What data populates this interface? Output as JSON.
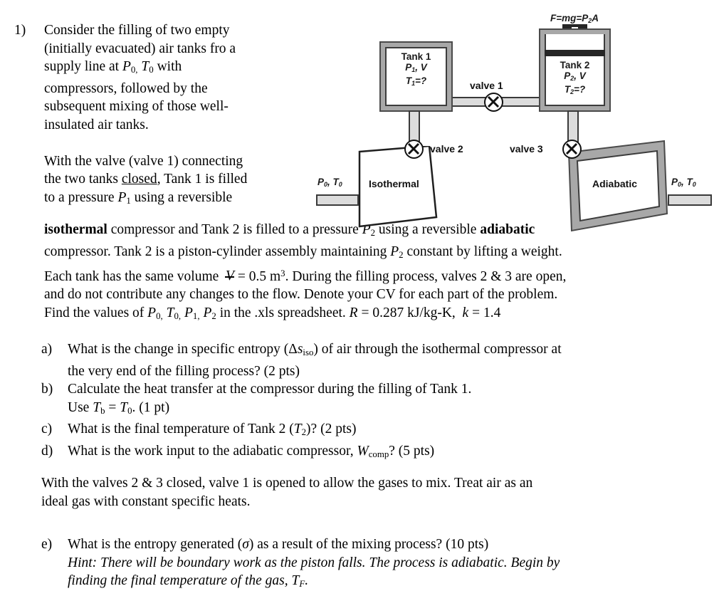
{
  "problem": {
    "number": "1)",
    "intro_lines": [
      "Consider the filling of two empty",
      "(initially evacuated) air tanks fro a",
      "supply line at P0, T0 with",
      "compressors, followed by the",
      "subsequent mixing of those well-",
      "insulated air tanks."
    ],
    "second_block_lines": [
      "With the valve (valve 1) connecting",
      "the two tanks closed, Tank 1 is filled",
      "to a pressure P1 using a reversible"
    ],
    "continuation": "isothermal compressor and Tank 2 is filled to a pressure P2 using a reversible adiabatic compressor. Tank 2 is a piston-cylinder assembly maintaining P2 constant by lifting a weight. Each tank has the same volume V = 0.5 m3. During the filling process, valves 2 & 3 are open, and do not contribute any changes to the flow. Denote your CV for each part of the problem. Find the values of P0, T0, P1, P2 in the .xls spreadsheet. R = 0.287 kJ/kg-K, k = 1.4",
    "emphasis": {
      "underlined_word": "closed",
      "bold_word_1": "isothermal",
      "bold_word_2": "adiabatic"
    },
    "constants": {
      "volume": "0.5 m3",
      "gas_constant": "0.287 kJ/kg-K",
      "k": "1.4"
    }
  },
  "questions": [
    {
      "marker": "a)",
      "lines": [
        "What is the change in specific entropy (Δsiso) of air through the isothermal compressor at",
        "the very end of the filling process? (2 pts)"
      ],
      "points": "2 pts"
    },
    {
      "marker": "b)",
      "lines": [
        "Calculate the heat transfer at the compressor during the filling of Tank 1.",
        "Use Tb = T0. (1 pt)"
      ],
      "points": "1 pt"
    },
    {
      "marker": "c)",
      "lines": [
        "What is the final temperature of Tank 2 (T2)? (2 pts)"
      ],
      "points": "2 pts"
    },
    {
      "marker": "d)",
      "lines": [
        "What is the work input to the adiabatic compressor, Wcomp? (5 pts)"
      ],
      "points": "5 pts"
    }
  ],
  "mixing_paragraph": [
    "With the valves 2 & 3 closed, valve 1 is opened to allow the gases to mix. Treat air as an",
    "ideal gas with constant specific heats."
  ],
  "question_e": {
    "marker": "e)",
    "text": "What is the entropy generated (σ) as a result of the mixing process? (10 pts)",
    "points": "10 pts",
    "hint_lines": [
      "Hint: There will be boundary work as the piston falls. The process is adiabatic. Begin by",
      "finding the final temperature of the gas, TF."
    ]
  },
  "figure": {
    "force_label": "F=mg=P2A",
    "tank1": {
      "name": "Tank 1",
      "line2": "P1, V",
      "line3": "T1=?"
    },
    "tank2": {
      "name": "Tank 2",
      "line2": "P2, V",
      "line3": "T2=?"
    },
    "valves": [
      {
        "id": "valve-1",
        "label": "valve 1",
        "glyph": "X"
      },
      {
        "id": "valve-2",
        "label": "valve 2",
        "glyph": "X"
      },
      {
        "id": "valve-3",
        "label": "valve 3",
        "glyph": "X"
      }
    ],
    "compressors": [
      {
        "id": "isothermal",
        "label": "Isothermal"
      },
      {
        "id": "adiabatic",
        "label": "Adiabatic"
      }
    ],
    "inlet_labels": {
      "left": "P0, T0",
      "right": "P0, T0"
    },
    "colors": {
      "tank_frame": "#a8a8a8",
      "pipe_fill": "#dcdcdc",
      "outline": "#3a3a3a",
      "piston": "#262626",
      "page_background": "#ffffff",
      "text": "#000000"
    }
  }
}
